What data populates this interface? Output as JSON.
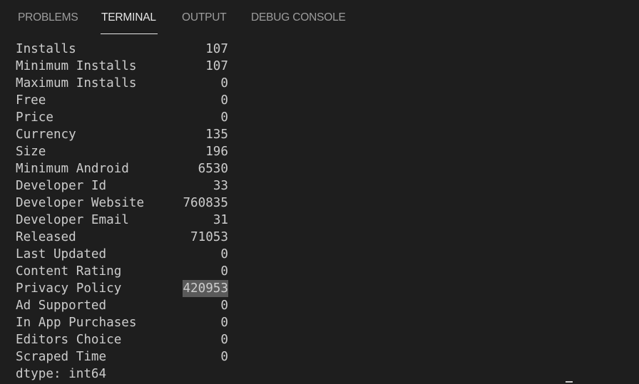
{
  "tabs": [
    {
      "label": "PROBLEMS",
      "active": false
    },
    {
      "label": "TERMINAL",
      "active": true
    },
    {
      "label": "OUTPUT",
      "active": false
    },
    {
      "label": "DEBUG CONSOLE",
      "active": false
    }
  ],
  "terminal": {
    "rows": [
      {
        "label": "Installs",
        "value": "107"
      },
      {
        "label": "Minimum Installs",
        "value": "107"
      },
      {
        "label": "Maximum Installs",
        "value": "0"
      },
      {
        "label": "Free",
        "value": "0"
      },
      {
        "label": "Price",
        "value": "0"
      },
      {
        "label": "Currency",
        "value": "135"
      },
      {
        "label": "Size",
        "value": "196"
      },
      {
        "label": "Minimum Android",
        "value": "6530"
      },
      {
        "label": "Developer Id",
        "value": "33"
      },
      {
        "label": "Developer Website",
        "value": "760835"
      },
      {
        "label": "Developer Email",
        "value": "31"
      },
      {
        "label": "Released",
        "value": "71053"
      },
      {
        "label": "Last Updated",
        "value": "0"
      },
      {
        "label": "Content Rating",
        "value": "0"
      },
      {
        "label": "Privacy Policy",
        "value": "420953"
      },
      {
        "label": "Ad Supported",
        "value": "0"
      },
      {
        "label": "In App Purchases",
        "value": "0"
      },
      {
        "label": "Editors Choice",
        "value": "0"
      },
      {
        "label": "Scraped Time",
        "value": "0"
      }
    ],
    "dtype_line": "dtype: int64",
    "selected_value": "420953"
  },
  "colors": {
    "background": "#1e1e1e",
    "text": "#cccccc",
    "tab_inactive": "#9d9d9d",
    "tab_active": "#e7e7e7",
    "selection": "#5a5a5a"
  }
}
